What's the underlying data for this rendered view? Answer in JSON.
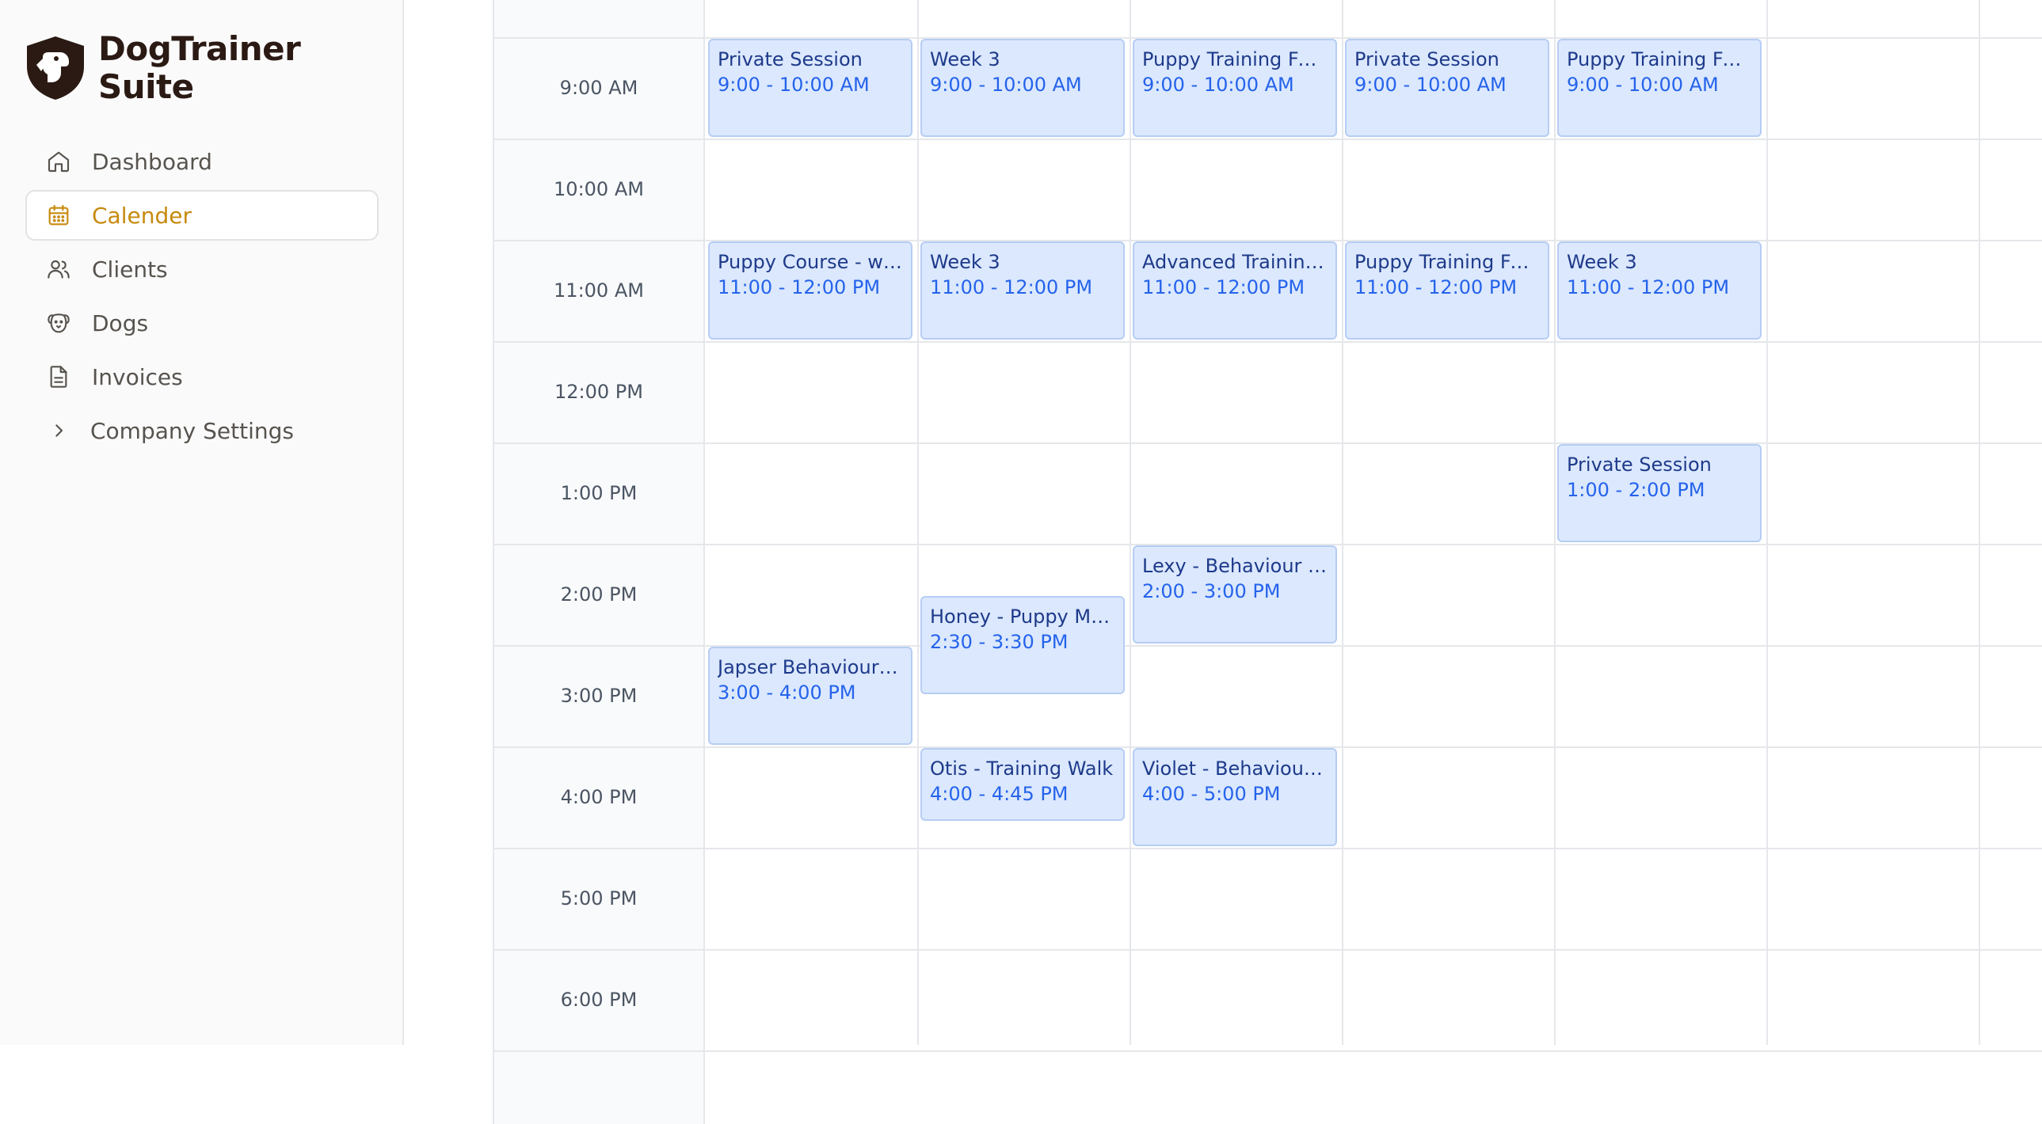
{
  "brand": {
    "name_line1": "DogTrainer",
    "name_line2": "Suite",
    "logo": "dog-shield-logo",
    "color": "#2b1a14"
  },
  "nav": {
    "items": [
      {
        "label": "Dashboard",
        "icon": "home-icon"
      },
      {
        "label": "Calender",
        "icon": "calendar-icon"
      },
      {
        "label": "Clients",
        "icon": "users-icon"
      },
      {
        "label": "Dogs",
        "icon": "dog-icon"
      },
      {
        "label": "Invoices",
        "icon": "document-icon"
      },
      {
        "label": "Company Settings",
        "icon": "chevron-right-icon"
      }
    ],
    "active_index": 1
  },
  "colors": {
    "accent": "#c78a0e",
    "event_bg": "#dbe8fe",
    "event_border": "#b6cdf4",
    "event_title": "#1e3a8a",
    "event_time": "#2563eb"
  },
  "calendar": {
    "times": [
      "9:00 AM",
      "10:00 AM",
      "11:00 AM",
      "12:00 PM",
      "1:00 PM",
      "2:00 PM",
      "3:00 PM",
      "4:00 PM",
      "5:00 PM",
      "6:00 PM"
    ],
    "events": [
      {
        "title": "Private Session",
        "time": "9:00 - 10:00 AM",
        "day": 0,
        "start": 9,
        "end": 10
      },
      {
        "title": "Week 3",
        "time": "9:00 - 10:00 AM",
        "day": 1,
        "start": 9,
        "end": 10
      },
      {
        "title": "Puppy Training Fun...",
        "time": "9:00 - 10:00 AM",
        "day": 2,
        "start": 9,
        "end": 10
      },
      {
        "title": "Private Session",
        "time": "9:00 - 10:00 AM",
        "day": 3,
        "start": 9,
        "end": 10
      },
      {
        "title": "Puppy Training Fun...",
        "time": "9:00 - 10:00 AM",
        "day": 4,
        "start": 9,
        "end": 10
      },
      {
        "title": "Puppy Course - we...",
        "time": "11:00 - 12:00 PM",
        "day": 0,
        "start": 11,
        "end": 12
      },
      {
        "title": "Week 3",
        "time": "11:00 - 12:00 PM",
        "day": 1,
        "start": 11,
        "end": 12
      },
      {
        "title": "Advanced Training ...",
        "time": "11:00 - 12:00 PM",
        "day": 2,
        "start": 11,
        "end": 12
      },
      {
        "title": "Puppy Training Fun...",
        "time": "11:00 - 12:00 PM",
        "day": 3,
        "start": 11,
        "end": 12
      },
      {
        "title": "Week 3",
        "time": "11:00 - 12:00 PM",
        "day": 4,
        "start": 11,
        "end": 12
      },
      {
        "title": "Private Session",
        "time": "1:00 - 2:00 PM",
        "day": 4,
        "start": 13,
        "end": 14
      },
      {
        "title": "Lexy - Behaviour M...",
        "time": "2:00 - 3:00 PM",
        "day": 2,
        "start": 14,
        "end": 15
      },
      {
        "title": "Honey - Puppy Mee...",
        "time": "2:30 - 3:30 PM",
        "day": 1,
        "start": 14.5,
        "end": 15.5
      },
      {
        "title": "Japser Behaviour M...",
        "time": "3:00 - 4:00 PM",
        "day": 0,
        "start": 15,
        "end": 16
      },
      {
        "title": "Otis - Training Walk",
        "time": "4:00 - 4:45 PM",
        "day": 1,
        "start": 16,
        "end": 16.75
      },
      {
        "title": "Violet - Behaviour ...",
        "time": "4:00 - 5:00 PM",
        "day": 2,
        "start": 16,
        "end": 17
      }
    ]
  }
}
